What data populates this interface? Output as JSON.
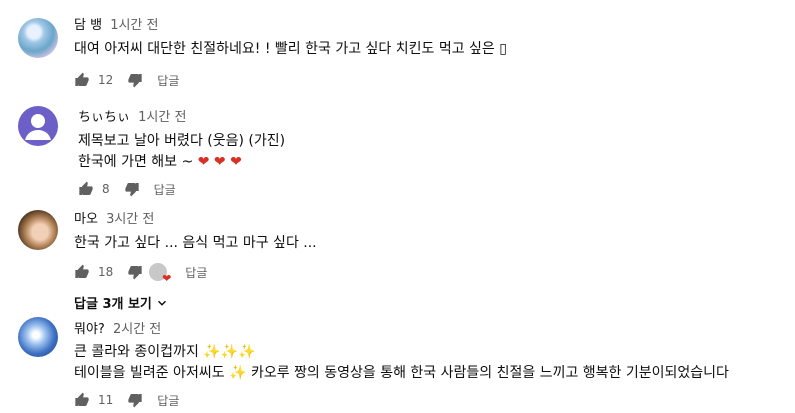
{
  "comments": [
    {
      "author": "담 뱅",
      "time": "1시간 전",
      "lines": [
        "대여 아저씨 대단한 친절하네요! ! 빨리 한국 가고 싶다 치킨도 먹고 싶은 ▯"
      ],
      "likes": "12",
      "reply": "답글"
    },
    {
      "author": "ちぃちぃ",
      "time": "1시간 전",
      "lines": [
        "제목보고 날아 버렸다 (웃음) (가진)",
        "한국에 가면 해보 ~"
      ],
      "likes": "8",
      "reply": "답글"
    },
    {
      "author": "마오",
      "time": "3시간 전",
      "lines": [
        "한국 가고 싶다 ... 음식 먹고 마구 싶다 ..."
      ],
      "likes": "18",
      "reply": "답글",
      "view_replies": "답글 3개 보기"
    },
    {
      "author": "뭐야?",
      "time": "2시간 전",
      "lines": [
        "큰 콜라와 종이컵까지",
        "테이블을 빌려준 아저씨도",
        "카오루 짱의 동영상을 통해 한국 사람들의 친절을 느끼고 행복한 기분이되었습니다"
      ],
      "likes": "11",
      "reply": "답글"
    }
  ],
  "icons": {
    "like": "thumbs-up-icon",
    "dislike": "thumbs-down-icon",
    "heart": "heart-icon",
    "sparkle": "sparkle-icon",
    "expand": "chevron-down-icon"
  },
  "colors": {
    "heart": "#d93025",
    "sparkle": "#d6a300",
    "meta": "#606060"
  }
}
